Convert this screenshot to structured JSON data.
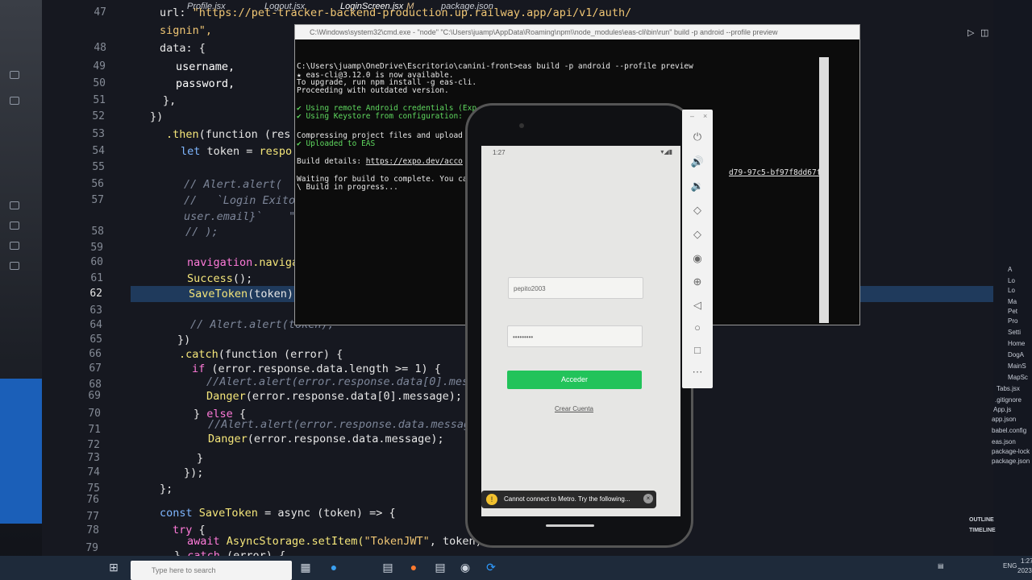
{
  "editor": {
    "tabs": [
      {
        "label": "Profile.jsx",
        "active": false,
        "modified": false
      },
      {
        "label": "Logout.jsx",
        "active": false,
        "modified": false
      },
      {
        "label": "LoginScreen.jsx",
        "active": true,
        "modified": true,
        "modified_marker": "M"
      },
      {
        "label": "package.json",
        "active": false,
        "modified": false
      }
    ],
    "line_numbers": [
      "47",
      "48",
      "49",
      "50",
      "51",
      "52",
      "53",
      "54",
      "55",
      "56",
      "57",
      "58",
      "59",
      "60",
      "61",
      "62",
      "63",
      "64",
      "65",
      "66",
      "67",
      "68",
      "69",
      "70",
      "71",
      "72",
      "73",
      "74",
      "75",
      "76",
      "77",
      "78",
      "79",
      "80"
    ],
    "current_line": "62",
    "code": {
      "l47a": "url: ",
      "l47b": "\"https://pet-tracker-backend-production.up.railway.app/api/v1/auth/",
      "l47c": "signin",
      "l47d": "\",",
      "l48": "data: {",
      "l49": "username,",
      "l50": "password,",
      "l51": "},",
      "l52": "})",
      "l53a": ".then",
      "l53b": "(function (res",
      "l54a": "let ",
      "l54b": "token = ",
      "l54c": "respo",
      "l56": "// Alert.alert(",
      "l57": "//   `Login Exito",
      "l57b": "user.email}`",
      "l57c": "\"",
      "l58": "// );",
      "l60a": "navigation",
      "l60b": ".naviga",
      "l61a": "Success",
      "l61b": "();",
      "l62a": "SaveToken",
      "l62b": "(token);",
      "l64": "// Alert.alert(token);",
      "l65": "})",
      "l66a": ".catch",
      "l66b": "(function (error) {",
      "l67a": "if ",
      "l67b": "(error.response.data.length >= 1) {",
      "l68": "//Alert.alert(error.response.data[0].messa",
      "l69a": "Danger",
      "l69b": "(error.response.data[0].message);",
      "l70a": "} ",
      "l70b": "else",
      "l70c": " {",
      "l71": "//Alert.alert(error.response.data.message)",
      "l72a": "Danger",
      "l72b": "(error.response.data.message);",
      "l73": "}",
      "l74": "});",
      "l75": "};",
      "l77a": "const ",
      "l77b": "SaveToken",
      "l77c": " = async (token) => {",
      "l78a": "try",
      "l78b": " {",
      "l79a": "await ",
      "l79b": "AsyncStorage",
      "l79c": ".setItem(",
      "l79d": "\"TokenJWT\"",
      "l79e": ", token);",
      "l80a": "} ",
      "l80b": "catch",
      "l80c": " (error) {"
    }
  },
  "cmd": {
    "title": "C:\\Windows\\system32\\cmd.exe - \"node\"   \"C:\\Users\\juamp\\AppData\\Roaming\\npm\\\\node_modules\\eas-cli\\bin\\run\" build -p android --profile preview",
    "lines": [
      "C:\\Users\\juamp\\OneDrive\\Escritorio\\canini-front>eas build -p android --profile preview",
      "★ eas-cli@3.12.0 is now available.",
      "To upgrade, run npm install -g eas-cli.",
      "Proceeding with outdated version.",
      "",
      "✔ Using remote Android credentials (Exp",
      "✔ Using Keystore from configuration:",
      "",
      "Compressing project files and upload",
      "✔ Uploaded to EAS",
      "",
      "Build details: ",
      "",
      "Waiting for build to complete. You ca",
      "\\ Build in progress..."
    ],
    "build_link": "https://expo.dev/acco",
    "right_fragment_1": "chive",
    "right_fragment_2": "d79-97c5-bf97f8dd67f4"
  },
  "phone": {
    "status_time": "1:27",
    "status_icons": "▾◢▮",
    "username_value": "pepito2003",
    "password_value": "•••••••••",
    "login_button": "Acceder",
    "create_account_link": "Crear Cuenta",
    "toast_text": "Cannot connect to Metro.  Try the following..."
  },
  "emulator_toolbar": {
    "buttons": [
      "power-icon",
      "volume-up-icon",
      "volume-down-icon",
      "rotate-left-icon",
      "rotate-right-icon",
      "camera-icon",
      "zoom-icon",
      "back-icon",
      "home-icon",
      "overview-icon",
      "more-icon"
    ],
    "close": "×",
    "minimize": "–"
  },
  "explorer": {
    "items": [
      "A",
      "Lo",
      "Lo",
      "Ma",
      "Pet",
      "Pro",
      "Setti",
      "Home",
      "DogA",
      "MainS",
      "MapSc",
      "Tabs.jsx",
      ".gitignore",
      "App.js",
      "app.json",
      "babel.config",
      "eas.json",
      "package-lock",
      "package.json"
    ],
    "outline": "OUTLINE",
    "timeline": "TIMELINE"
  },
  "taskbar": {
    "search_placeholder": "Type here to search",
    "lang": "ENG",
    "time": "1:27",
    "date": "2023-"
  }
}
